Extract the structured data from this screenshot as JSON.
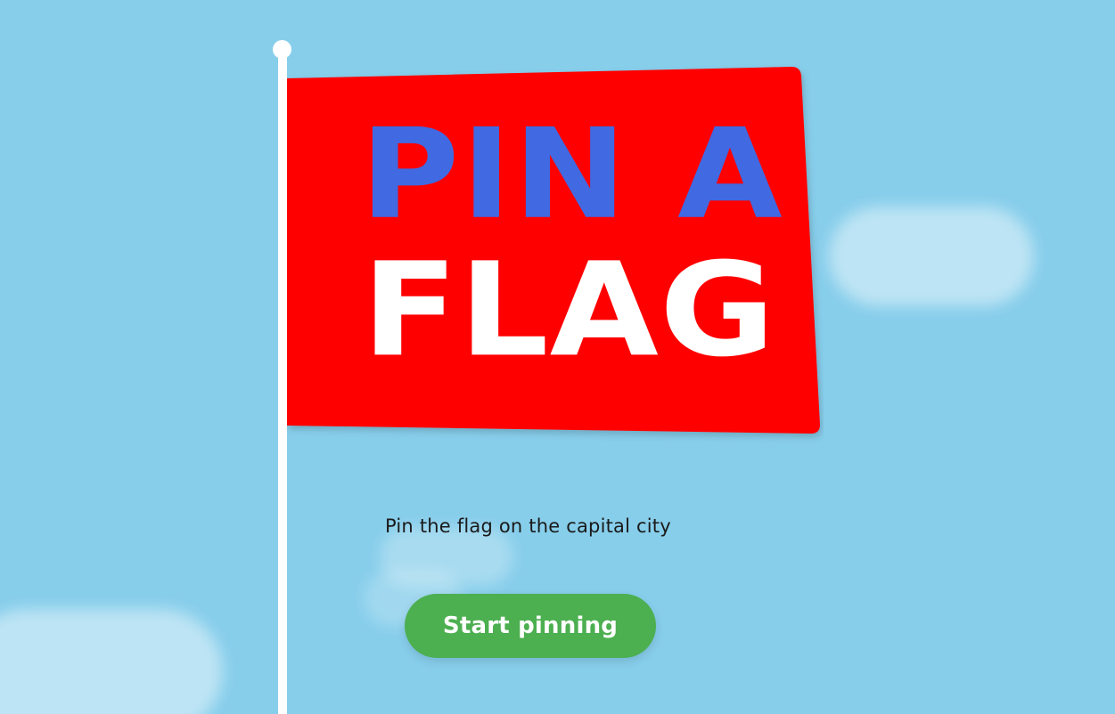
{
  "title": {
    "line1": "PIN A",
    "line2": "FLAG"
  },
  "subtitle": "Pin the flag on the capital city",
  "start_button_label": "Start pinning",
  "colors": {
    "sky": "#87ceeb",
    "flag": "#ff0000",
    "title_line1": "#4169e1",
    "title_line2": "#ffffff",
    "button": "#4caf50",
    "pole": "#ffffff"
  }
}
